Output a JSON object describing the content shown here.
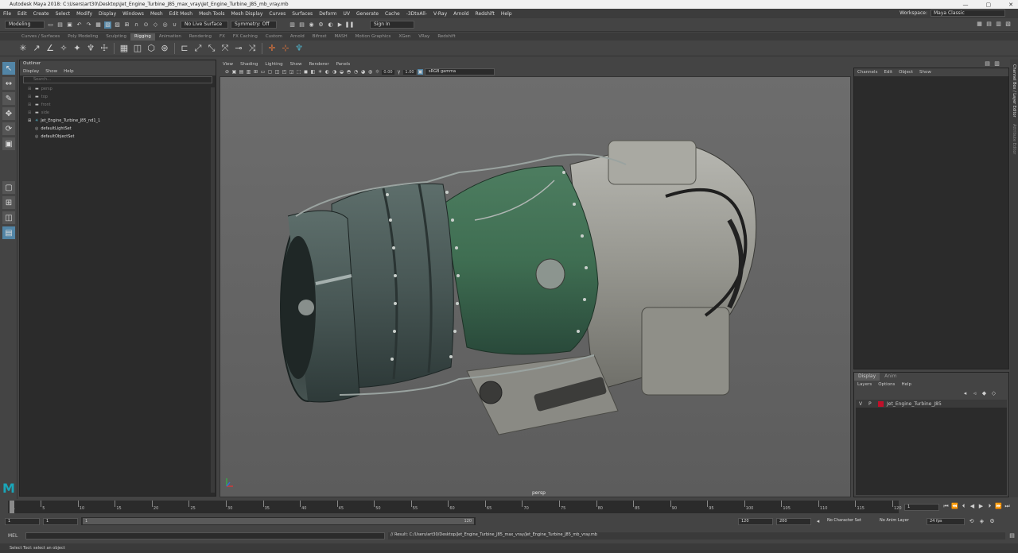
{
  "window": {
    "title": "Autodesk Maya 2018: C:\\Users\\art30\\Desktop\\Jet_Engine_Turbine_J85_max_vray\\Jet_Engine_Turbine_J85_mb_vray.mb",
    "min": "—",
    "max": "▢",
    "close": "✕"
  },
  "menu": [
    "File",
    "Edit",
    "Create",
    "Select",
    "Modify",
    "Display",
    "Windows",
    "Mesh",
    "Edit Mesh",
    "Mesh Tools",
    "Mesh Display",
    "Curves",
    "Surfaces",
    "Deform",
    "UV",
    "Generate",
    "Cache",
    "-3DtoAll-",
    "V-Ray",
    "Arnold",
    "Redshift",
    "Help"
  ],
  "workspace": {
    "label": "Workspace:",
    "value": "Maya Classic"
  },
  "status": {
    "mode": "Modeling",
    "live_surface": "No Live Surface",
    "symmetry": "Symmetry: Off",
    "sign_in": "Sign In"
  },
  "shelf_tabs": [
    "Curves / Surfaces",
    "Poly Modeling",
    "Sculpting",
    "Rigging",
    "Animation",
    "Rendering",
    "FX",
    "FX Caching",
    "Custom",
    "Arnold",
    "Bifrost",
    "MASH",
    "Motion Graphics",
    "XGen",
    "VRay",
    "Redshift"
  ],
  "shelf_active": "Rigging",
  "outliner": {
    "title": "Outliner",
    "menu": [
      "Display",
      "Show",
      "Help"
    ],
    "search_placeholder": "Search...",
    "items": [
      {
        "label": "persp",
        "dim": true,
        "icon": "camera-icon"
      },
      {
        "label": "top",
        "dim": true,
        "icon": "camera-icon"
      },
      {
        "label": "front",
        "dim": true,
        "icon": "camera-icon"
      },
      {
        "label": "side",
        "dim": true,
        "icon": "camera-icon"
      },
      {
        "label": "Jet_Engine_Turbine_J85_nd1_1",
        "dim": false,
        "icon": "transform-icon"
      },
      {
        "label": "defaultLightSet",
        "dim": false,
        "icon": "set-icon"
      },
      {
        "label": "defaultObjectSet",
        "dim": false,
        "icon": "set-icon"
      }
    ]
  },
  "viewport": {
    "menu": [
      "View",
      "Shading",
      "Lighting",
      "Show",
      "Renderer",
      "Panels"
    ],
    "exposure": "0.00",
    "gamma": "1.00",
    "color_space": "sRGB gamma",
    "camera_label": "persp"
  },
  "channel_box": {
    "menu": [
      "Channels",
      "Edit",
      "Object",
      "Show"
    ]
  },
  "layer_editor": {
    "tabs": [
      "Display",
      "Anim"
    ],
    "menu": [
      "Layers",
      "Options",
      "Help"
    ],
    "layer": {
      "v": "V",
      "p": "P",
      "name": "Jet_Engine_Turbine_J85",
      "color": "#c0102a"
    }
  },
  "timeline": {
    "ticks": [
      "1",
      "5",
      "10",
      "15",
      "20",
      "25",
      "30",
      "35",
      "40",
      "45",
      "50",
      "55",
      "60",
      "65",
      "70",
      "75",
      "80",
      "85",
      "90",
      "95",
      "100",
      "105",
      "110",
      "115",
      "120"
    ],
    "current_frame": "1"
  },
  "range": {
    "start": "1",
    "inner_start": "1",
    "slider_start": "1",
    "slider_end": "120",
    "end": "120",
    "outer_end": "200",
    "character_set": "No Character Set",
    "anim_layer": "No Anim Layer",
    "fps": "24 fps"
  },
  "command": {
    "lang": "MEL",
    "result": "// Result: C:/Users/art30/Desktop/Jet_Engine_Turbine_J85_max_vray/Jet_Engine_Turbine_J85_mb_vray.mb"
  },
  "help_line": "Select Tool: select an object",
  "right_strip": {
    "tab1": "Channel Box / Layer Editor",
    "tab2": "Attribute Editor"
  },
  "colors": {
    "accent": "#5285a6",
    "engine_green": "#3f6e52",
    "engine_steel": "#4e5e5c"
  }
}
